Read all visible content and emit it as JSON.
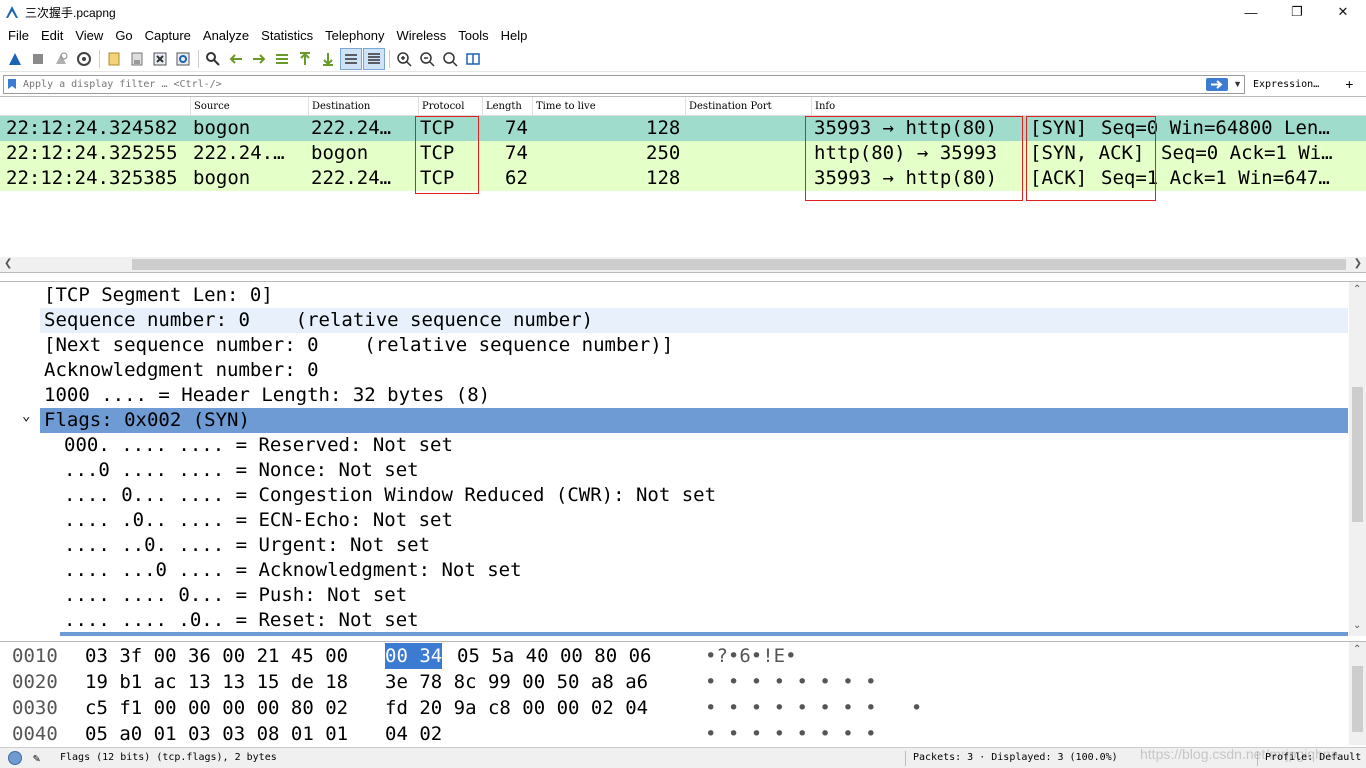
{
  "window": {
    "title": "三次握手.pcapng",
    "minimize": "—",
    "restore": "❐",
    "close": "✕"
  },
  "menu": [
    "File",
    "Edit",
    "View",
    "Go",
    "Capture",
    "Analyze",
    "Statistics",
    "Telephony",
    "Wireless",
    "Tools",
    "Help"
  ],
  "filter": {
    "placeholder": "Apply a display filter … <Ctrl-/>",
    "expression_label": "Expression…",
    "add_label": "+"
  },
  "packet_list": {
    "columns": [
      "Source",
      "Destination",
      "Protocol",
      "Length",
      "Time to live",
      "Destination Port",
      "Info"
    ],
    "rows": [
      {
        "time": "22:12:24.324582",
        "source": "bogon",
        "destination": "222.24…",
        "protocol": "TCP",
        "length": "74",
        "ttl": "128",
        "dport": "",
        "info_ports": "35993 → http(80)",
        "info_flags": "[SYN]",
        "info_rest": "Seq=0 Win=64800 Len…",
        "bg": "#a0dccb"
      },
      {
        "time": "22:12:24.325255",
        "source": "222.24.…",
        "destination": "bogon",
        "protocol": "TCP",
        "length": "74",
        "ttl": "250",
        "dport": "",
        "info_ports": "http(80) → 35993",
        "info_flags": "[SYN, ACK]",
        "info_rest": "Seq=0 Ack=1 Wi…",
        "bg": "#e4ffc7"
      },
      {
        "time": "22:12:24.325385",
        "source": "bogon",
        "destination": "222.24…",
        "protocol": "TCP",
        "length": "62",
        "ttl": "128",
        "dport": "",
        "info_ports": "35993 → http(80)",
        "info_flags": "[ACK]",
        "info_rest": "Seq=1 Ack=1 Win=647…",
        "bg": "#e4ffc7"
      }
    ]
  },
  "details": {
    "rows": [
      "[TCP Segment Len: 0]",
      "Sequence number: 0    (relative sequence number)",
      "[Next sequence number: 0    (relative sequence number)]",
      "Acknowledgment number: 0",
      "1000 .... = Header Length: 32 bytes (8)",
      "Flags: 0x002 (SYN)",
      "000. .... .... = Reserved: Not set",
      "...0 .... .... = Nonce: Not set",
      ".... 0... .... = Congestion Window Reduced (CWR): Not set",
      ".... .0.. .... = ECN-Echo: Not set",
      ".... ..0. .... = Urgent: Not set",
      ".... ...0 .... = Acknowledgment: Not set",
      ".... .... 0... = Push: Not set",
      ".... .... .0.. = Reset: Not set"
    ],
    "expander": "⌄"
  },
  "bytes": {
    "rows": [
      {
        "offset": "0010",
        "hex_a": "03 3f 00 36 00 21 45 00",
        "hex_sel": "00 34",
        "hex_b": "05 5a 40 00 80 06",
        "ascii": "•?•6•!E•"
      },
      {
        "offset": "0020",
        "hex_a": "19 b1 ac 13 13 15 de 18",
        "hex_sel": "",
        "hex_b": "3e 78 8c 99 00 50 a8 a6",
        "ascii": "• • • • • • • •"
      },
      {
        "offset": "0030",
        "hex_a": "c5 f1 00 00 00 00 80 02",
        "hex_sel": "",
        "hex_b": "fd 20 9a c8 00 00 02 04",
        "ascii": "• • • • • • • •   •"
      },
      {
        "offset": "0040",
        "hex_a": "05 a0 01 03 03 08 01 01",
        "hex_sel": "",
        "hex_b": "04 02",
        "ascii": "• • • • • • • •"
      }
    ]
  },
  "status": {
    "field_info": "Flags (12 bits) (tcp.flags), 2 bytes",
    "packets": "Packets: 3 · Displayed: 3 (100.0%)",
    "profile": "Profile: Default",
    "watermark": "https://blog.csdn.net/mrjpgiqhna"
  },
  "colors": {
    "selected_row": "#6e9bd4",
    "highlight_row": "#e8f1fb",
    "accent": "#3b7bd2"
  }
}
